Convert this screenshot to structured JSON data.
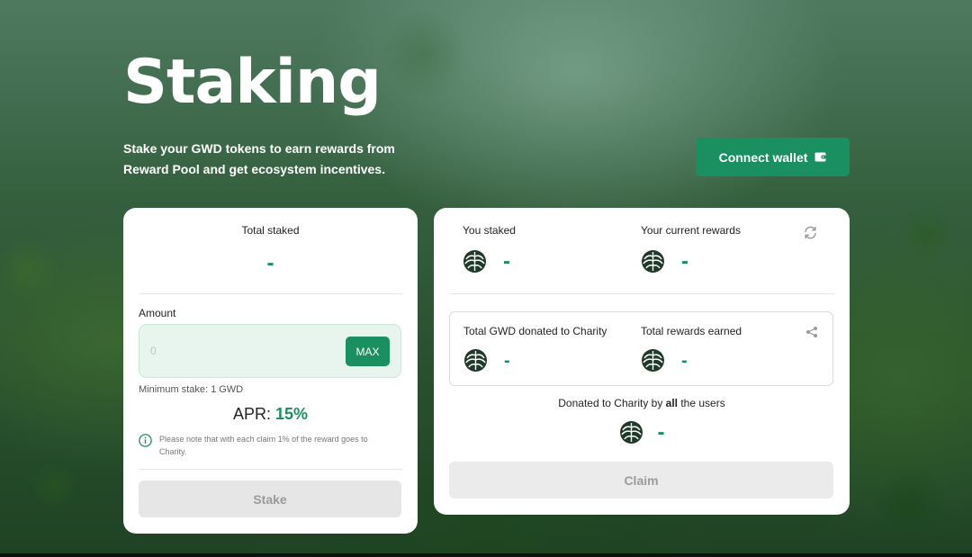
{
  "hero": {
    "title": "Staking",
    "subtitle": "Stake your GWD tokens to earn rewards from Reward Pool and get ecosystem incentives."
  },
  "header": {
    "connect_wallet_label": "Connect wallet",
    "connect_wallet_icon": "wallet-icon"
  },
  "stake_card": {
    "total_staked_label": "Total staked",
    "total_staked_value": "-",
    "amount_label": "Amount",
    "amount_placeholder": "0",
    "max_label": "MAX",
    "min_stake": "Minimum stake: 1 GWD",
    "apr_label": "APR:",
    "apr_value": "15%",
    "note": "Please note that with each claim 1% of the reward goes to Charity.",
    "stake_label": "Stake"
  },
  "rewards_card": {
    "you_staked_label": "You staked",
    "you_staked_value": "-",
    "current_rewards_label": "Your current rewards",
    "current_rewards_value": "-",
    "total_donated_label": "Total GWD donated to Charity",
    "total_donated_value": "-",
    "total_rewards_label": "Total rewards earned",
    "total_rewards_value": "-",
    "charity_all_prefix": "Donated to Charity by ",
    "charity_all_bold": "all",
    "charity_all_suffix": " the users",
    "charity_all_value": "-",
    "claim_label": "Claim"
  },
  "colors": {
    "accent": "#1a9060",
    "token_icon": "#1f3a2a",
    "disabled_bg": "#e6e6e6",
    "disabled_text": "#9a9a9a"
  }
}
